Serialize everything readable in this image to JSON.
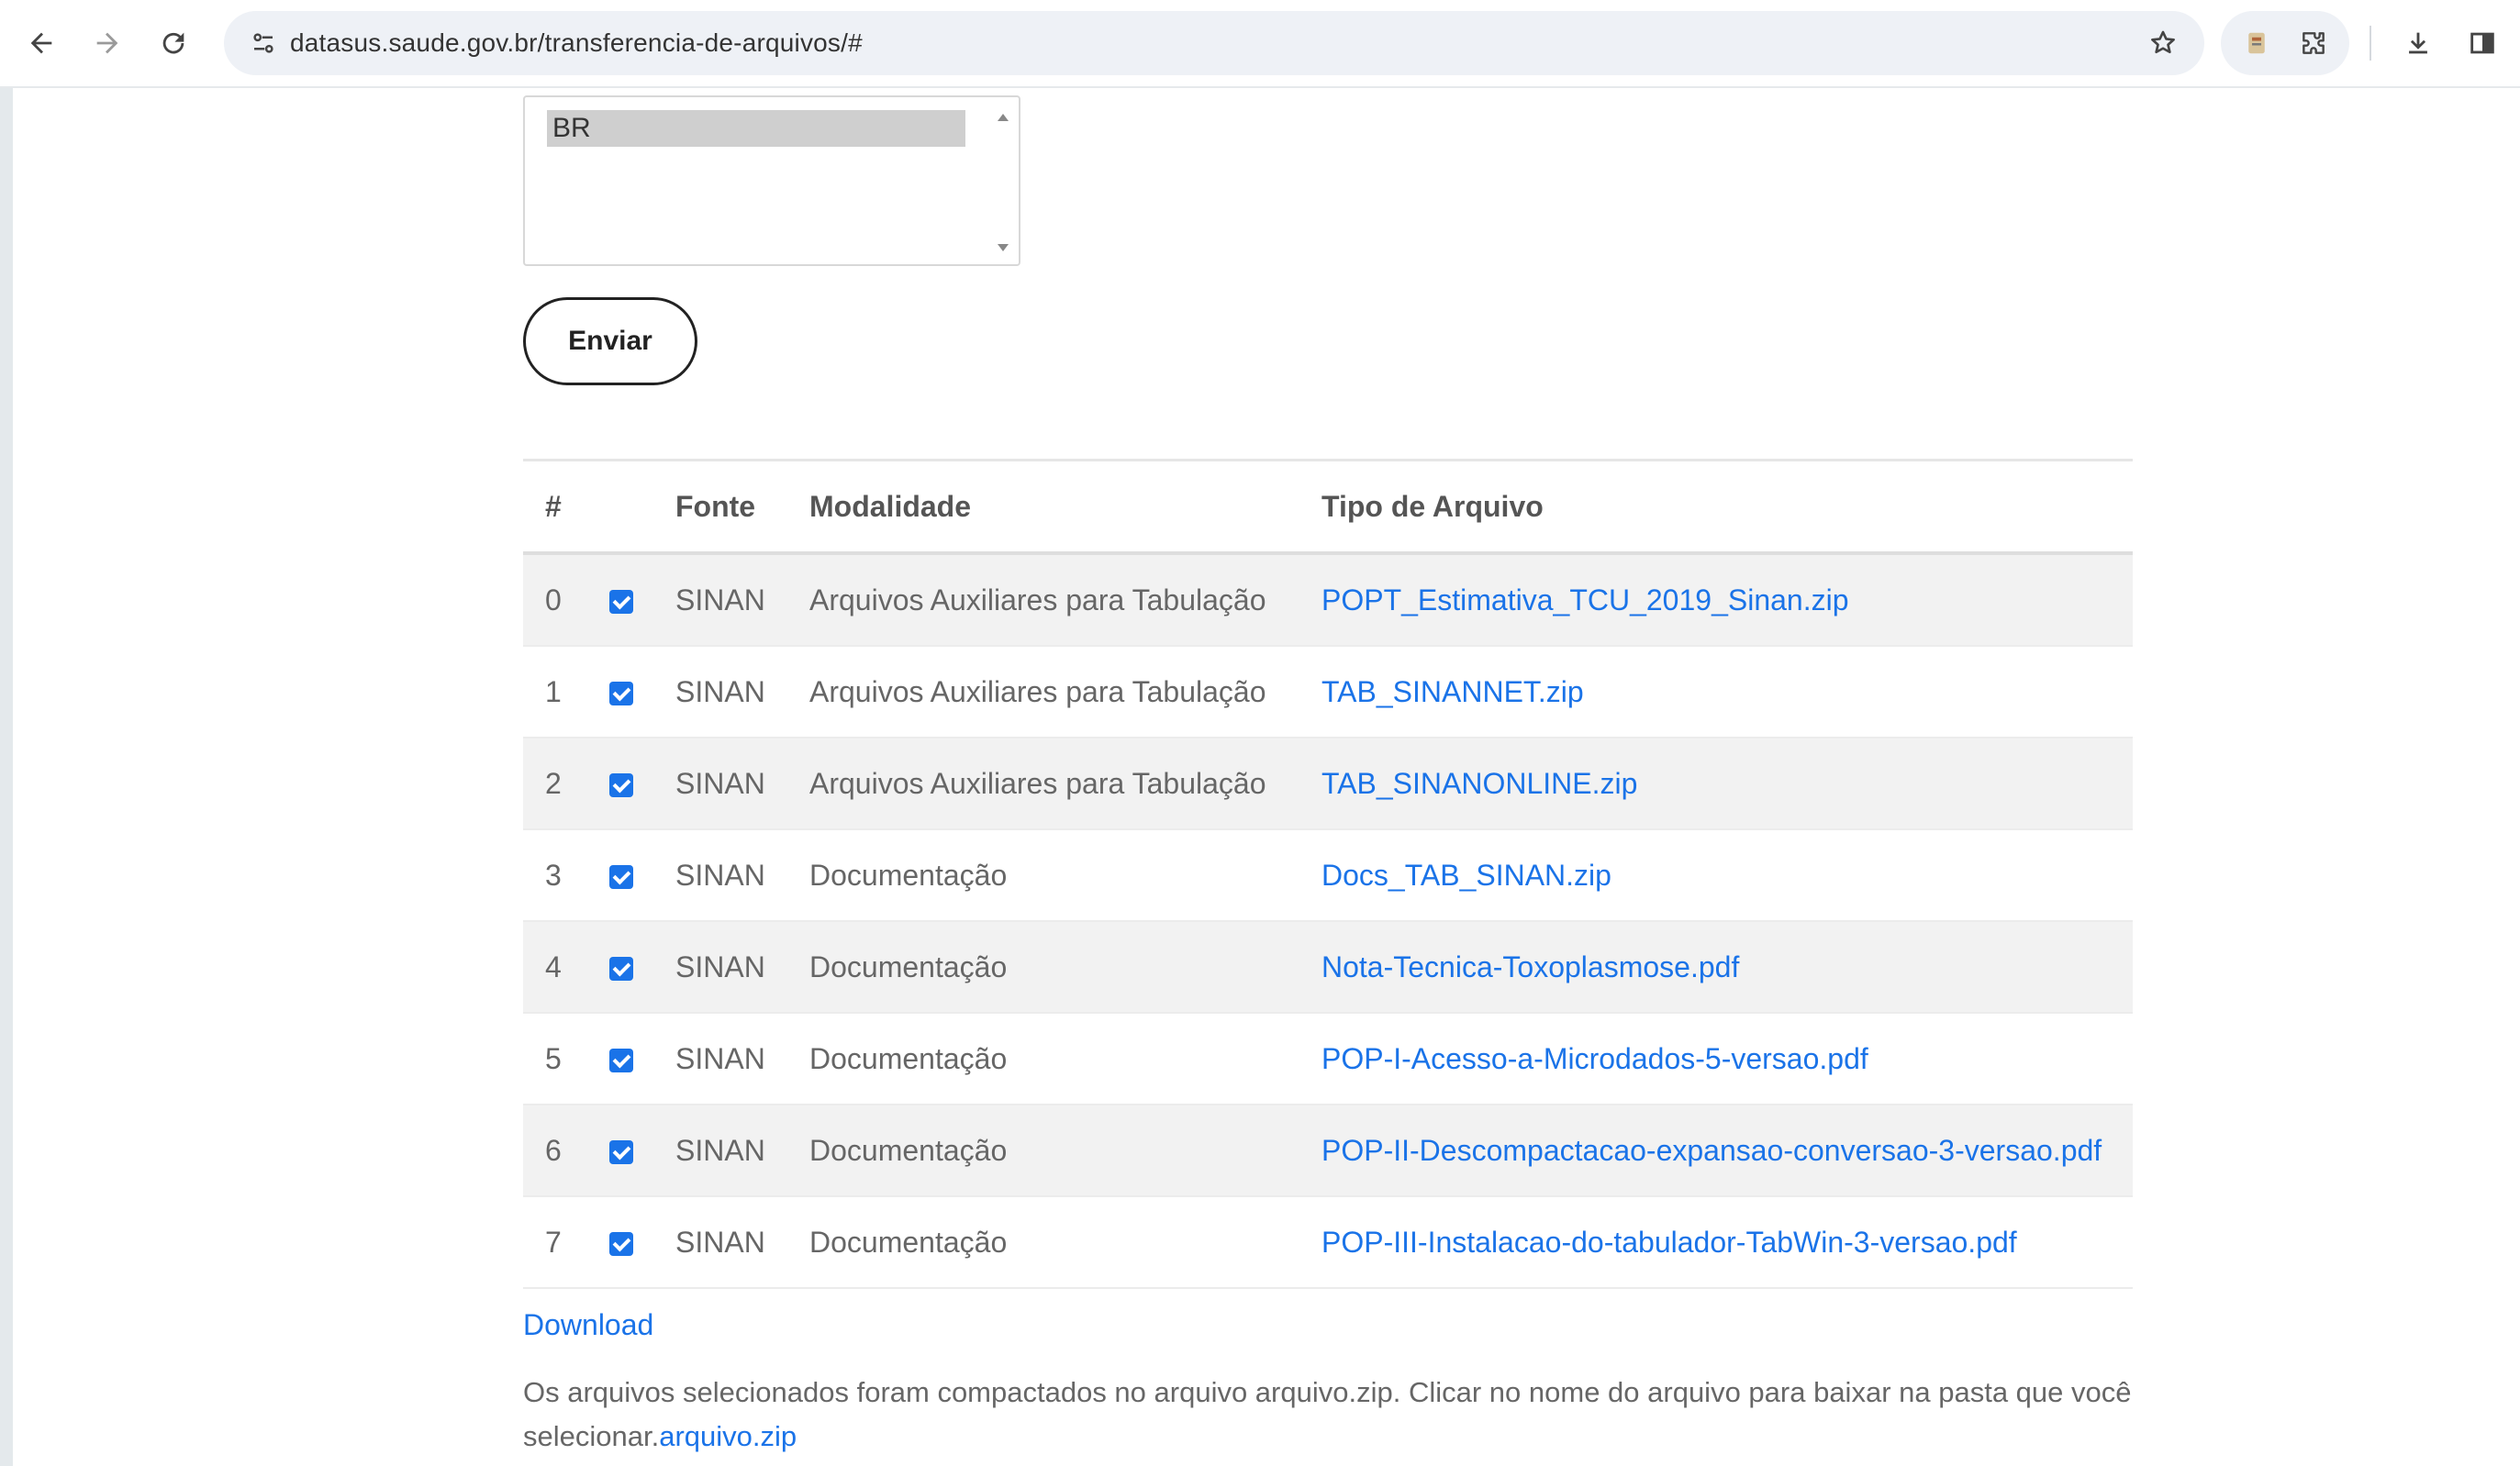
{
  "browser": {
    "url": "datasus.saude.gov.br/transferencia-de-arquivos/#"
  },
  "form": {
    "listbox_selected": "BR",
    "submit_label": "Enviar"
  },
  "table": {
    "headers": [
      "#",
      "",
      "Fonte",
      "Modalidade",
      "Tipo de Arquivo"
    ],
    "rows": [
      {
        "idx": "0",
        "checked": true,
        "fonte": "SINAN",
        "modalidade": "Arquivos Auxiliares para Tabulação",
        "arquivo": "POPT_Estimativa_TCU_2019_Sinan.zip"
      },
      {
        "idx": "1",
        "checked": true,
        "fonte": "SINAN",
        "modalidade": "Arquivos Auxiliares para Tabulação",
        "arquivo": "TAB_SINANNET.zip"
      },
      {
        "idx": "2",
        "checked": true,
        "fonte": "SINAN",
        "modalidade": "Arquivos Auxiliares para Tabulação",
        "arquivo": "TAB_SINANONLINE.zip"
      },
      {
        "idx": "3",
        "checked": true,
        "fonte": "SINAN",
        "modalidade": "Documentação",
        "arquivo": "Docs_TAB_SINAN.zip"
      },
      {
        "idx": "4",
        "checked": true,
        "fonte": "SINAN",
        "modalidade": "Documentação",
        "arquivo": "Nota-Tecnica-Toxoplasmose.pdf"
      },
      {
        "idx": "5",
        "checked": true,
        "fonte": "SINAN",
        "modalidade": "Documentação",
        "arquivo": "POP-I-Acesso-a-Microdados-5-versao.pdf"
      },
      {
        "idx": "6",
        "checked": true,
        "fonte": "SINAN",
        "modalidade": "Documentação",
        "arquivo": "POP-II-Descompactacao-expansao-conversao-3-versao.pdf"
      },
      {
        "idx": "7",
        "checked": true,
        "fonte": "SINAN",
        "modalidade": "Documentação",
        "arquivo": "POP-III-Instalacao-do-tabulador-TabWin-3-versao.pdf"
      }
    ]
  },
  "download": {
    "label": "Download",
    "note_text": "Os arquivos selecionados foram compactados no arquivo arquivo.zip. Clicar no nome do arquivo para baixar na pasta que você selecionar.",
    "file_link": "arquivo.zip"
  },
  "colors": {
    "link": "#1a73e8",
    "checkbox": "#1a73e8",
    "row_stripe": "#f2f2f2"
  },
  "icons": [
    "back-arrow-icon",
    "forward-arrow-icon",
    "reload-icon",
    "site-info-icon",
    "star-icon",
    "extension-icon",
    "puzzle-icon",
    "download-icon",
    "side-panel-icon"
  ]
}
